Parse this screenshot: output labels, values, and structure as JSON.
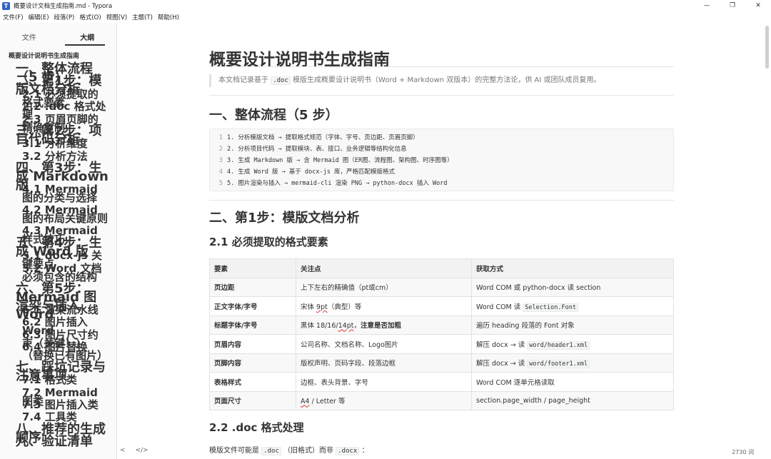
{
  "window": {
    "title": "概要设计文档生成指南.md - Typora",
    "app_icon": "T",
    "controls": [
      "—",
      "❐",
      "✕"
    ]
  },
  "menu": [
    "文件(F)",
    "编辑(E)",
    "段落(P)",
    "格式(O)",
    "视图(V)",
    "主题(T)",
    "帮助(H)"
  ],
  "sidebar": {
    "tabs": [
      "文件",
      "大纲"
    ],
    "active_tab": "大纲",
    "outline": [
      {
        "level": 1,
        "label": "概要设计说明书生成指南"
      },
      {
        "level": 2,
        "label": "一、整体流程（5 步）"
      },
      {
        "level": 2,
        "label": "二、第1步：模版文档分析"
      },
      {
        "level": 3,
        "label": "2.1 必须提取的格式要素"
      },
      {
        "level": 3,
        "label": "2.2 .doc 格式处理"
      },
      {
        "level": 3,
        "label": "2.3 页眉页脚的精确复制"
      },
      {
        "level": 2,
        "label": "三、第2步：项目代码分析"
      },
      {
        "level": 3,
        "label": "3.1 分析维度"
      },
      {
        "level": 3,
        "label": "3.2 分析方法"
      },
      {
        "level": 2,
        "label": "四、第3步：生成 Markdown 版"
      },
      {
        "level": 3,
        "label": "4.1 Mermaid 图的分类与选择"
      },
      {
        "level": 3,
        "label": "4.2 Mermaid 图的布局关键原则"
      },
      {
        "level": 3,
        "label": "4.3 Mermaid 样式技巧"
      },
      {
        "level": 2,
        "label": "五、第4步：生成 Word 版"
      },
      {
        "level": 3,
        "label": "5.1 docx-js 关键要点"
      },
      {
        "level": 3,
        "label": "5.2 Word 文档必须包含的结构"
      },
      {
        "level": 2,
        "label": "六、第5步：Mermaid 图渲染与插入 Word"
      },
      {
        "level": 3,
        "label": "6.1 渲染流水线"
      },
      {
        "level": 3,
        "label": "6.2 图片插入 Word"
      },
      {
        "level": 3,
        "label": "6.3 图片尺寸约束（关键！）"
      },
      {
        "level": 3,
        "label": "6.4 图片替换（替换已有图片）"
      },
      {
        "level": 2,
        "label": "七、踩坑记录与注意事项"
      },
      {
        "level": 3,
        "label": "7.1 格式类"
      },
      {
        "level": 3,
        "label": "7.2 Mermaid 图类"
      },
      {
        "level": 3,
        "label": "7.3 图片插入类"
      },
      {
        "level": 3,
        "label": "7.4 工具类"
      },
      {
        "level": 2,
        "label": "八、推荐的生成顺序"
      },
      {
        "level": 2,
        "label": "九、验证清单"
      }
    ]
  },
  "statusbar": {
    "back_icon": "<",
    "source_icon": "</>",
    "word_count": "2730 词"
  },
  "doc": {
    "title": "概要设计说明书生成指南",
    "quote_pre": "本文档记录基于",
    "quote_code": ".doc",
    "quote_post": "模版生成概要设计说明书（Word + Markdown 双版本）的完整方法论，供 AI 或团队成员复用。",
    "section1": "一、整体流程（5 步）",
    "code_lines": [
      {
        "n": "1",
        "text": "1. 分析模版文档 → 提取格式规范（字体、字号、页边距、页眉页脚）"
      },
      {
        "n": "2",
        "text": "2. 分析项目代码 → 提取模块、表、接口、业务逻辑等结构化信息"
      },
      {
        "n": "3",
        "text": "3. 生成 Markdown 版 → 含 Mermaid 图（ER图、流程图、架构图、时序图等）"
      },
      {
        "n": "4",
        "text": "4. 生成 Word 版 → 基于 docx-js 库，严格匹配模版格式"
      },
      {
        "n": "5",
        "text": "5. 图片渲染与插入 → mermaid-cli 渲染 PNG → python-docx 插入 Word"
      }
    ],
    "section2": "二、第1步：模版文档分析",
    "sub21": "2.1 必须提取的格式要素",
    "table": {
      "headers": [
        "要素",
        "关注点",
        "获取方式"
      ],
      "rows": [
        {
          "k": "页边距",
          "focus": "上下左右的精确值（pt或cm）",
          "how_pre": "Word COM 或 python-docx 读 section",
          "how_code": "",
          "how_post": ""
        },
        {
          "k": "正文字体/字号",
          "focus_pre": "宋体 ",
          "focus_sq": "9pt",
          "focus_post": "（典型）等",
          "how_pre": "Word COM 读 ",
          "how_code": "Selection.Font",
          "how_post": ""
        },
        {
          "k": "标题字体/字号",
          "focus_pre": "黑体 18/16/",
          "focus_sq": "14pt",
          "focus_post": "，",
          "focus_bold": "注意是否加粗",
          "how_pre": "遍历 heading 段落的 Font 对象",
          "how_code": "",
          "how_post": ""
        },
        {
          "k": "页眉内容",
          "focus": "公司名称、文档名称、Logo图片",
          "how_pre": "解压 docx → 读 ",
          "how_code": "word/header1.xml",
          "how_post": ""
        },
        {
          "k": "页脚内容",
          "focus": "版权声明、页码字段、段落边框",
          "how_pre": "解压 docx → 读 ",
          "how_code": "word/footer1.xml",
          "how_post": ""
        },
        {
          "k": "表格样式",
          "focus": "边框、表头背景、字号",
          "how_pre": "Word COM 逐单元格读取",
          "how_code": "",
          "how_post": ""
        },
        {
          "k": "页面尺寸",
          "focus_sq": "A4",
          "focus_post": " / Letter 等",
          "how_pre": "section.page_width / page_height",
          "how_code": "",
          "how_post": ""
        }
      ]
    },
    "sub22": "2.2 .doc 格式处理",
    "para_pre": "模版文件可能是",
    "para_code1": ".doc",
    "para_mid": "（旧格式）而非",
    "para_code2": ".docx",
    "para_post": "："
  }
}
